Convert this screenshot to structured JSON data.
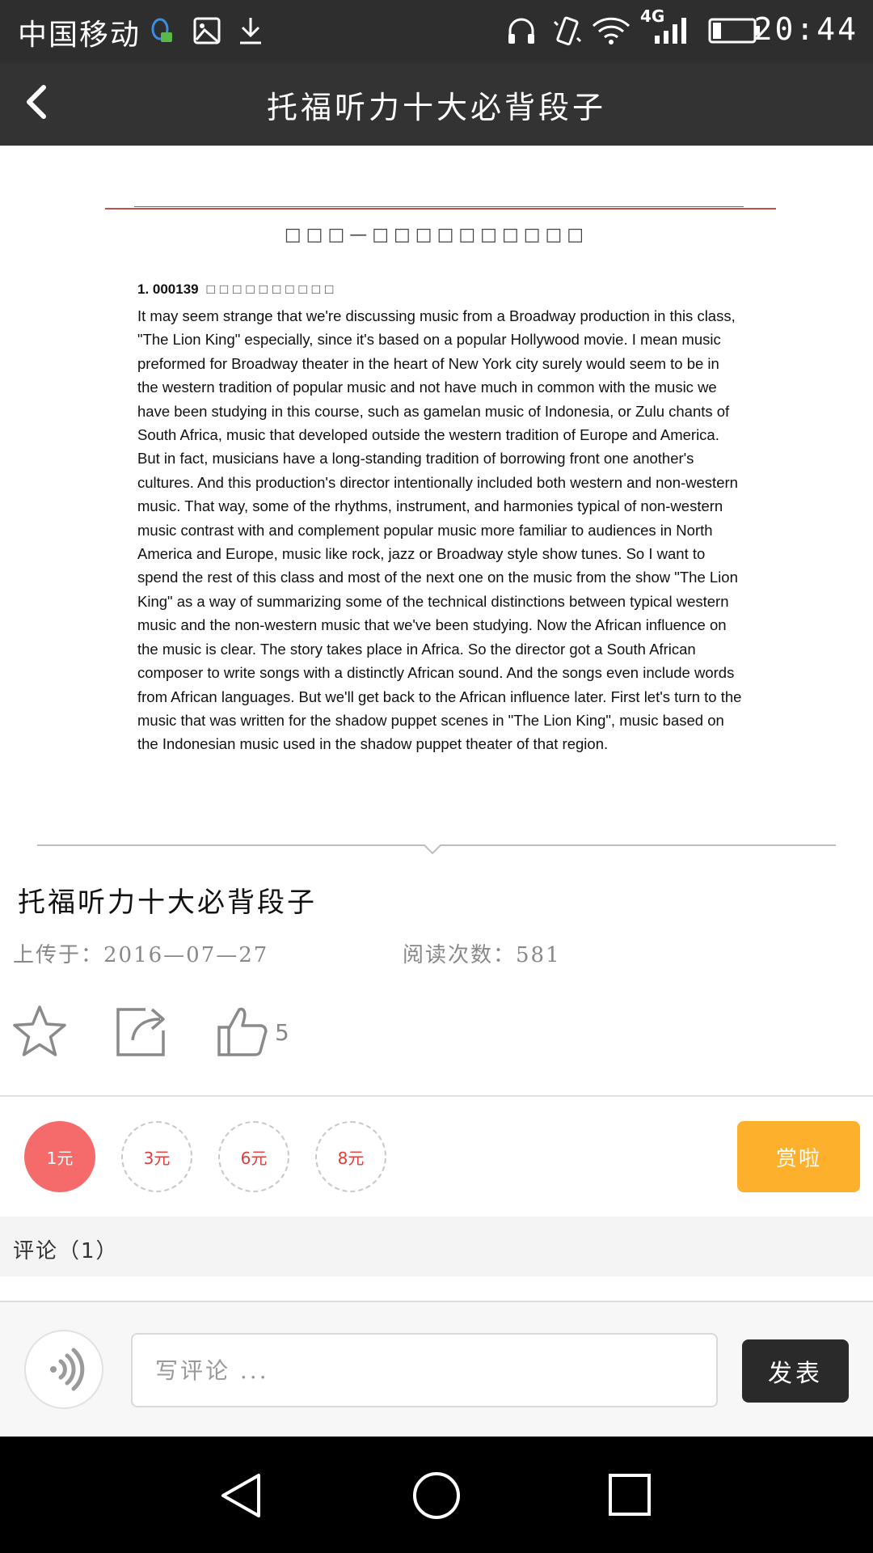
{
  "status_bar": {
    "carrier": "中国移动",
    "network": "4G",
    "time": "20:44",
    "icons": [
      "qq-notification-icon",
      "image-icon",
      "download-icon",
      "headphones-icon",
      "vibrate-icon",
      "wifi-icon",
      "signal-icon",
      "battery-icon"
    ]
  },
  "header": {
    "title": "托福听力十大必背段子",
    "back_icon": "chevron-left-icon"
  },
  "document": {
    "heading": "□□□—□□□□□□□□□□",
    "item_number": "1. 000139",
    "item_title": "□□□□□□□□□□",
    "paragraph": "It may seem strange that we're discussing music from a Broadway production in this class, \"The Lion King\" especially, since it's based on a popular Hollywood movie. I mean music preformed for Broadway theater in the heart of New York city surely would seem to be in the western tradition of popular music and not have much in common with the music we have been studying in this course, such as gamelan music of Indonesia, or Zulu chants of South Africa, music that developed outside the western tradition of Europe and America. But in fact, musicians have a long-standing tradition of borrowing front one another's cultures. And this production's director intentionally included both western and non-western music. That way, some of the rhythms, instrument, and harmonies typical of non-western music contrast with and complement popular music more familiar to audiences in North America and Europe, music like rock, jazz or Broadway style show tunes. So I want to spend the rest of this class and most of the next one on the music from the show \"The Lion King\" as a way of summarizing some of the technical distinctions between typical western music and the non-western music that we've been studying. Now the African influence on the music is clear. The story takes place in Africa. So the director got a South African composer to write songs with a distinctly African sound. And the songs even include words from African languages. But we'll get back to the African influence later. First let's turn to the music that was written for the shadow puppet scenes in \"The Lion King\", music based on the Indonesian music used in the shadow puppet theater of that region."
  },
  "article": {
    "title": "托福听力十大必背段子",
    "upload_label": "上传于：2016—07—27",
    "reads_label": "阅读次数：581",
    "like_count": "5",
    "action_icons": [
      "star-icon",
      "share-icon",
      "thumbs-up-icon"
    ]
  },
  "reward": {
    "options": [
      {
        "label": "1元",
        "selected": true
      },
      {
        "label": "3元",
        "selected": false
      },
      {
        "label": "6元",
        "selected": false
      },
      {
        "label": "8元",
        "selected": false
      }
    ],
    "button_label": "赏啦",
    "colors": {
      "selected": "#f56a6a",
      "button": "#fdb02c",
      "amount_text": "#e23b3b"
    }
  },
  "comments": {
    "header": "评论（1）"
  },
  "composer": {
    "voice_icon": "voice-icon",
    "placeholder": "写评论 ...",
    "value": "",
    "send_label": "发表"
  },
  "nav_bar": {
    "icons": [
      "back-triangle-icon",
      "home-circle-icon",
      "recents-square-icon"
    ]
  }
}
